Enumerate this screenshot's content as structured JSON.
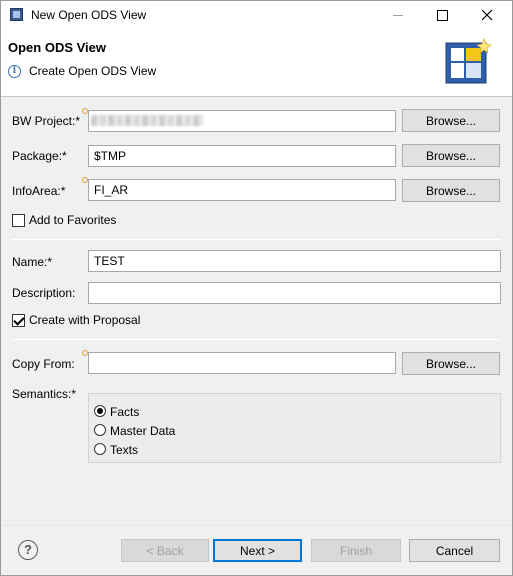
{
  "window": {
    "title": "New Open ODS View"
  },
  "header": {
    "title": "Open ODS View",
    "message": "Create Open ODS View",
    "info_icon": "i"
  },
  "form": {
    "bw_project": {
      "label": "BW Project:*",
      "value": ""
    },
    "package": {
      "label": "Package:*",
      "value": "$TMP"
    },
    "info_area": {
      "label": "InfoArea:*",
      "value": "FI_AR"
    },
    "add_to_favorites": {
      "label": "Add to Favorites",
      "checked": false
    },
    "name": {
      "label": "Name:*",
      "value": "TEST"
    },
    "description": {
      "label": "Description:",
      "value": ""
    },
    "create_with_proposal": {
      "label": "Create with Proposal",
      "checked": true
    },
    "copy_from": {
      "label": "Copy From:",
      "value": ""
    },
    "semantics": {
      "label": "Semantics:*",
      "options": [
        "Facts",
        "Master Data",
        "Texts"
      ],
      "selected": "Facts"
    },
    "browse_label": "Browse..."
  },
  "footer": {
    "help_glyph": "?",
    "back_label": "< Back",
    "next_label": "Next >",
    "finish_label": "Finish",
    "cancel_label": "Cancel"
  },
  "colors": {
    "accent": "#0078d7",
    "decoration": "#e0a030"
  }
}
